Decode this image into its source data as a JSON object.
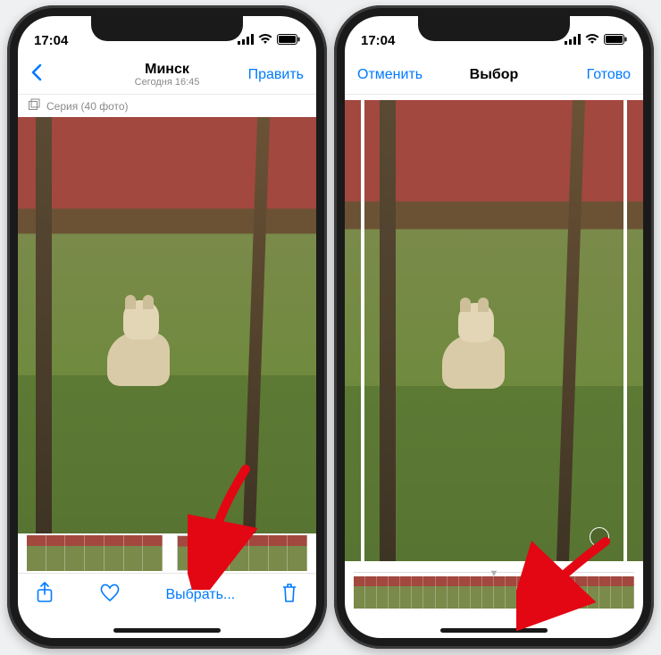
{
  "colors": {
    "accent": "#007aff",
    "arrow": "#e30613"
  },
  "left": {
    "status": {
      "time": "17:04"
    },
    "nav": {
      "title": "Минск",
      "subtitle": "Сегодня 16:45",
      "edit": "Править"
    },
    "burst": {
      "label": "Серия (40 фото)"
    },
    "toolbar": {
      "select": "Выбрать..."
    },
    "thumbs": {
      "count_before": 7,
      "count_after": 5
    }
  },
  "right": {
    "status": {
      "time": "17:04"
    },
    "nav": {
      "cancel": "Отменить",
      "title": "Выбор",
      "done": "Готово"
    },
    "thumbs": {
      "count": 24
    }
  }
}
